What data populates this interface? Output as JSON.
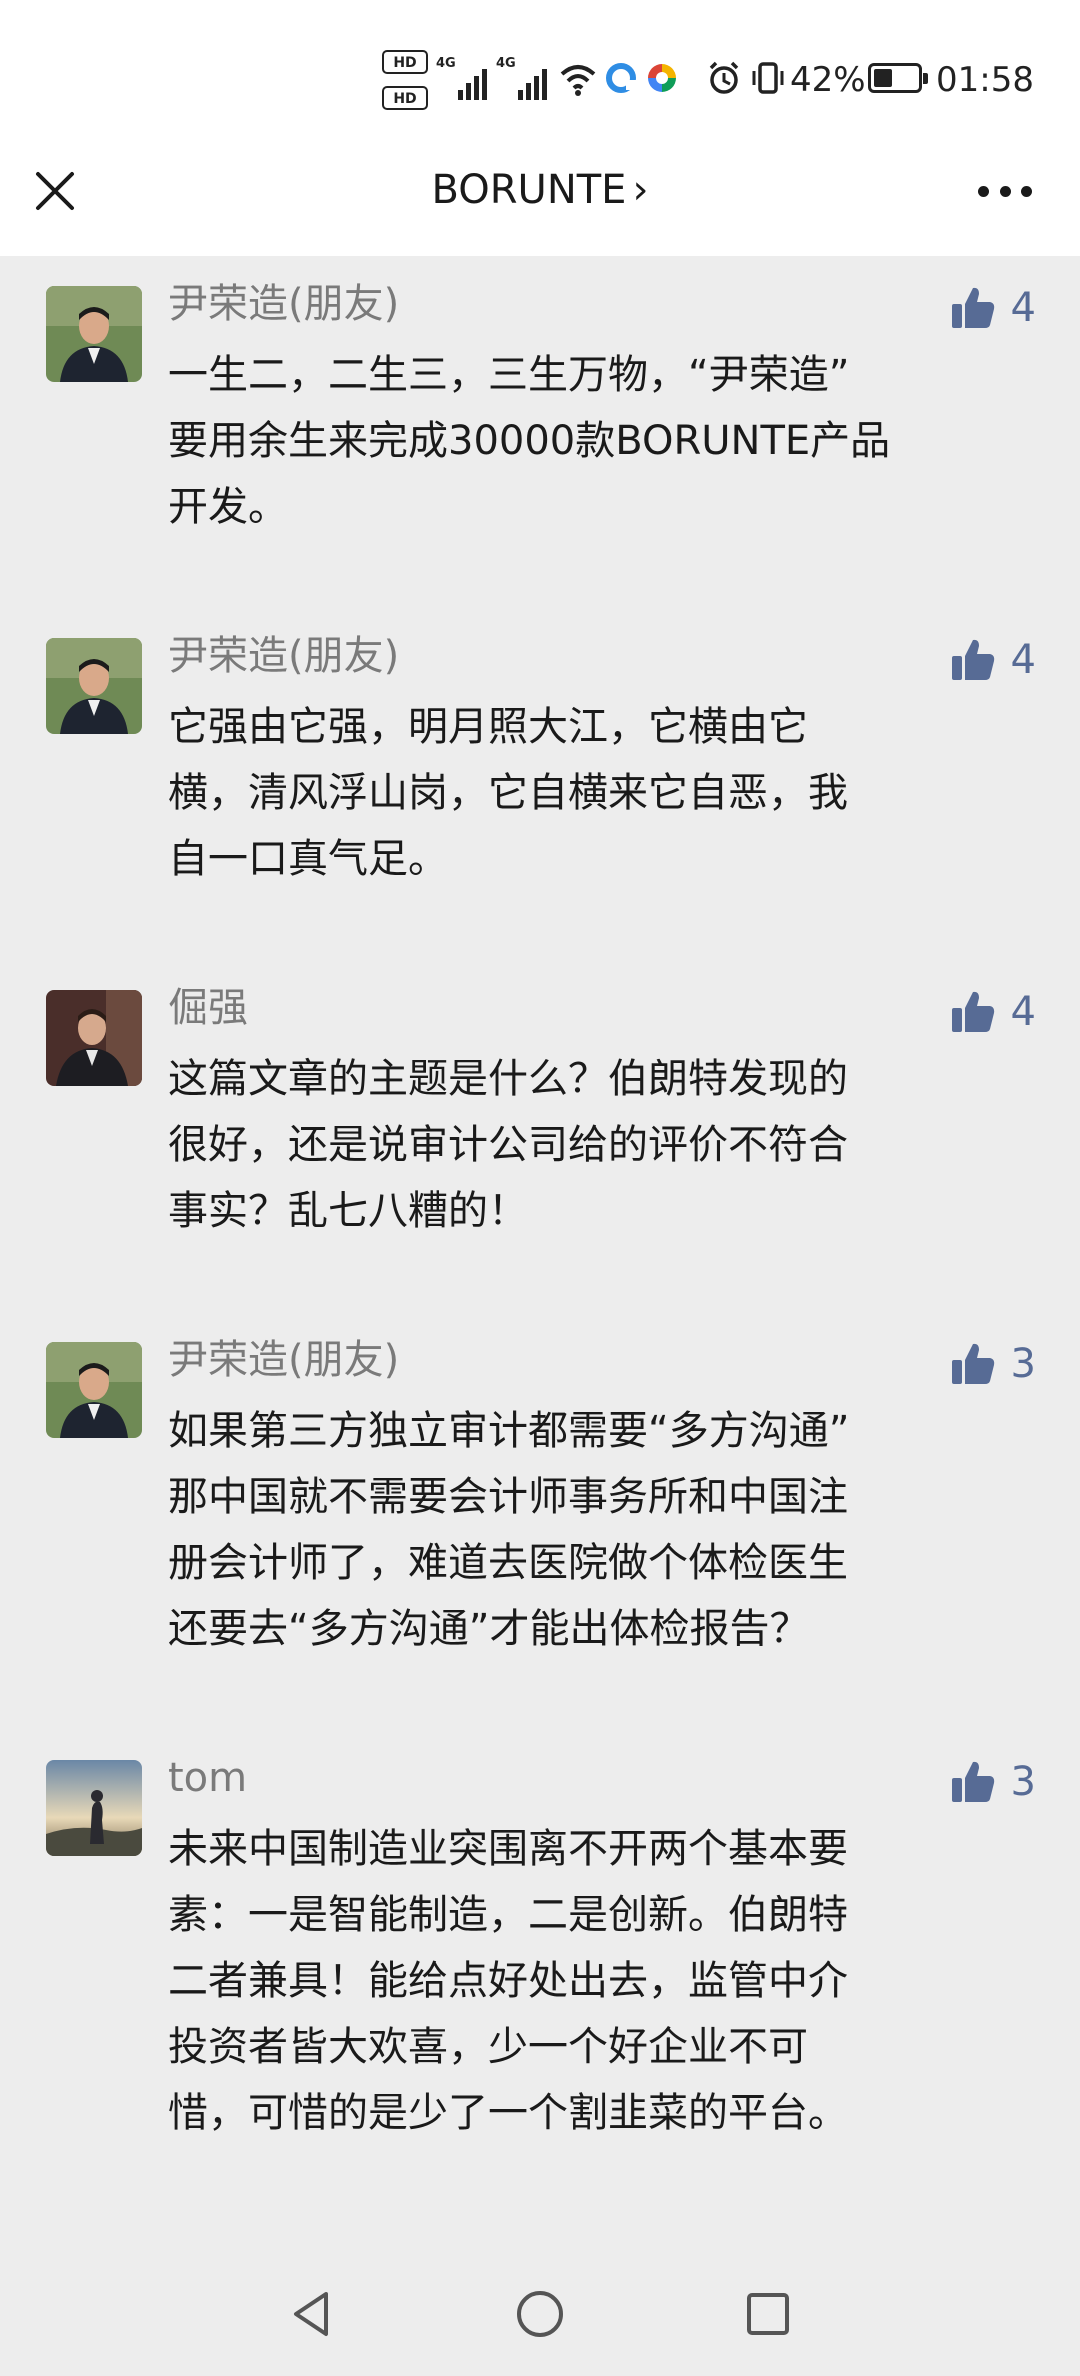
{
  "status_bar": {
    "hd_badges": [
      "HD",
      "HD"
    ],
    "signal_1": "4G",
    "signal_2": "4G",
    "battery_text": "42%",
    "battery_level": 0.42,
    "time": "01:58"
  },
  "nav": {
    "title": "BORUNTE",
    "chevron": "›"
  },
  "icons": {
    "close": "close-icon",
    "more": "more-icon",
    "like": "thumbs-up-icon"
  },
  "colors": {
    "like_blue": "#576b95",
    "background": "#ededed"
  },
  "comments": [
    {
      "name": "尹荣造(朋友)",
      "likes": "4",
      "text": "一生二，二生三，三生万物，“尹荣造”\n要用余生来完成30000款BORUNTE产品\n开发。"
    },
    {
      "name": "尹荣造(朋友)",
      "likes": "4",
      "text": "它强由它强，明月照大江，它横由它\n横，清风浮山岗，它自横来它自恶，我\n自一口真气足。"
    },
    {
      "name": "倔强",
      "likes": "4",
      "text": "这篇文章的主题是什么？伯朗特发现的\n很好，还是说审计公司给的评价不符合\n事实？乱七八糟的！"
    },
    {
      "name": "尹荣造(朋友)",
      "likes": "3",
      "text": "如果第三方独立审计都需要“多方沟通”\n那中国就不需要会计师事务所和中国注\n册会计师了，难道去医院做个体检医生\n还要去“多方沟通”才能出体检报告？"
    },
    {
      "name": "tom",
      "likes": "3",
      "text": "未来中国制造业突围离不开两个基本要\n素：一是智能制造，二是创新。伯朗特\n二者兼具！能给点好处出去，监管中介\n投资者皆大欢喜，少一个好企业不可\n惜，可惜的是少了一个割韭菜的平台。"
    }
  ],
  "system_nav": {
    "back": "back-triangle-icon",
    "home": "home-circle-icon",
    "recents": "recents-square-icon"
  }
}
